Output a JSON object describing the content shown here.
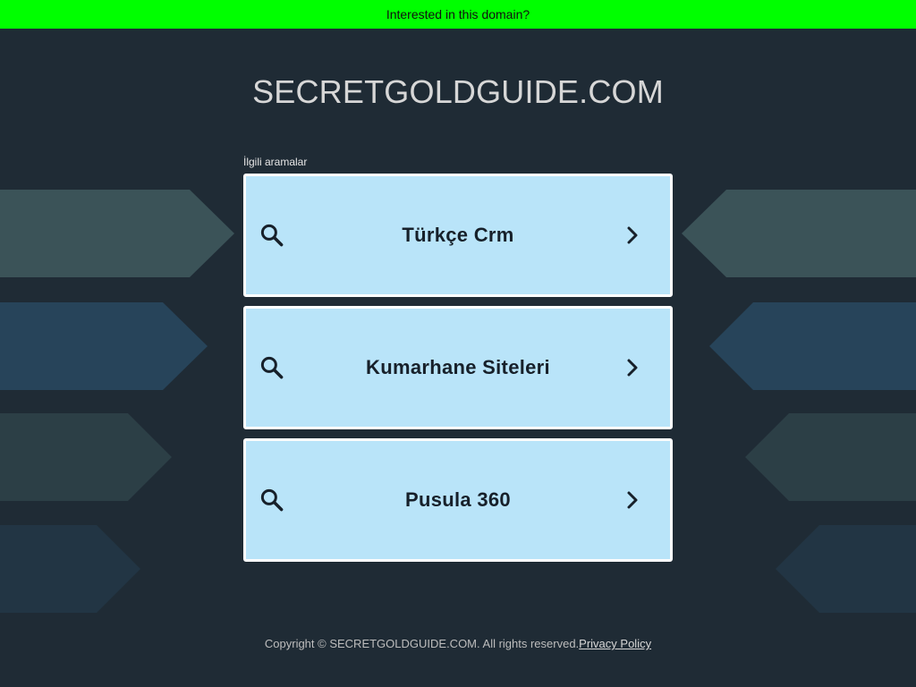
{
  "banner": {
    "text": "Interested in this domain?",
    "color": "#00ff00"
  },
  "site": {
    "title": "SECRETGOLDGUIDE.COM"
  },
  "related": {
    "label": "İlgili aramalar",
    "items": [
      {
        "label": "Türkçe Crm",
        "icon": "search-icon",
        "arrow": "chevron-right-icon"
      },
      {
        "label": "Kumarhane Siteleri",
        "icon": "search-icon",
        "arrow": "chevron-right-icon"
      },
      {
        "label": "Pusula 360",
        "icon": "search-icon",
        "arrow": "chevron-right-icon"
      }
    ]
  },
  "footer": {
    "copyright": "Copyright © SECRETGOLDGUIDE.COM.  All rights reserved.",
    "privacy_label": "Privacy Policy"
  },
  "colors": {
    "background": "#1f2b35",
    "card": "#b9e4f9",
    "card_border": "#ffffff",
    "text_dark": "#17202a"
  }
}
